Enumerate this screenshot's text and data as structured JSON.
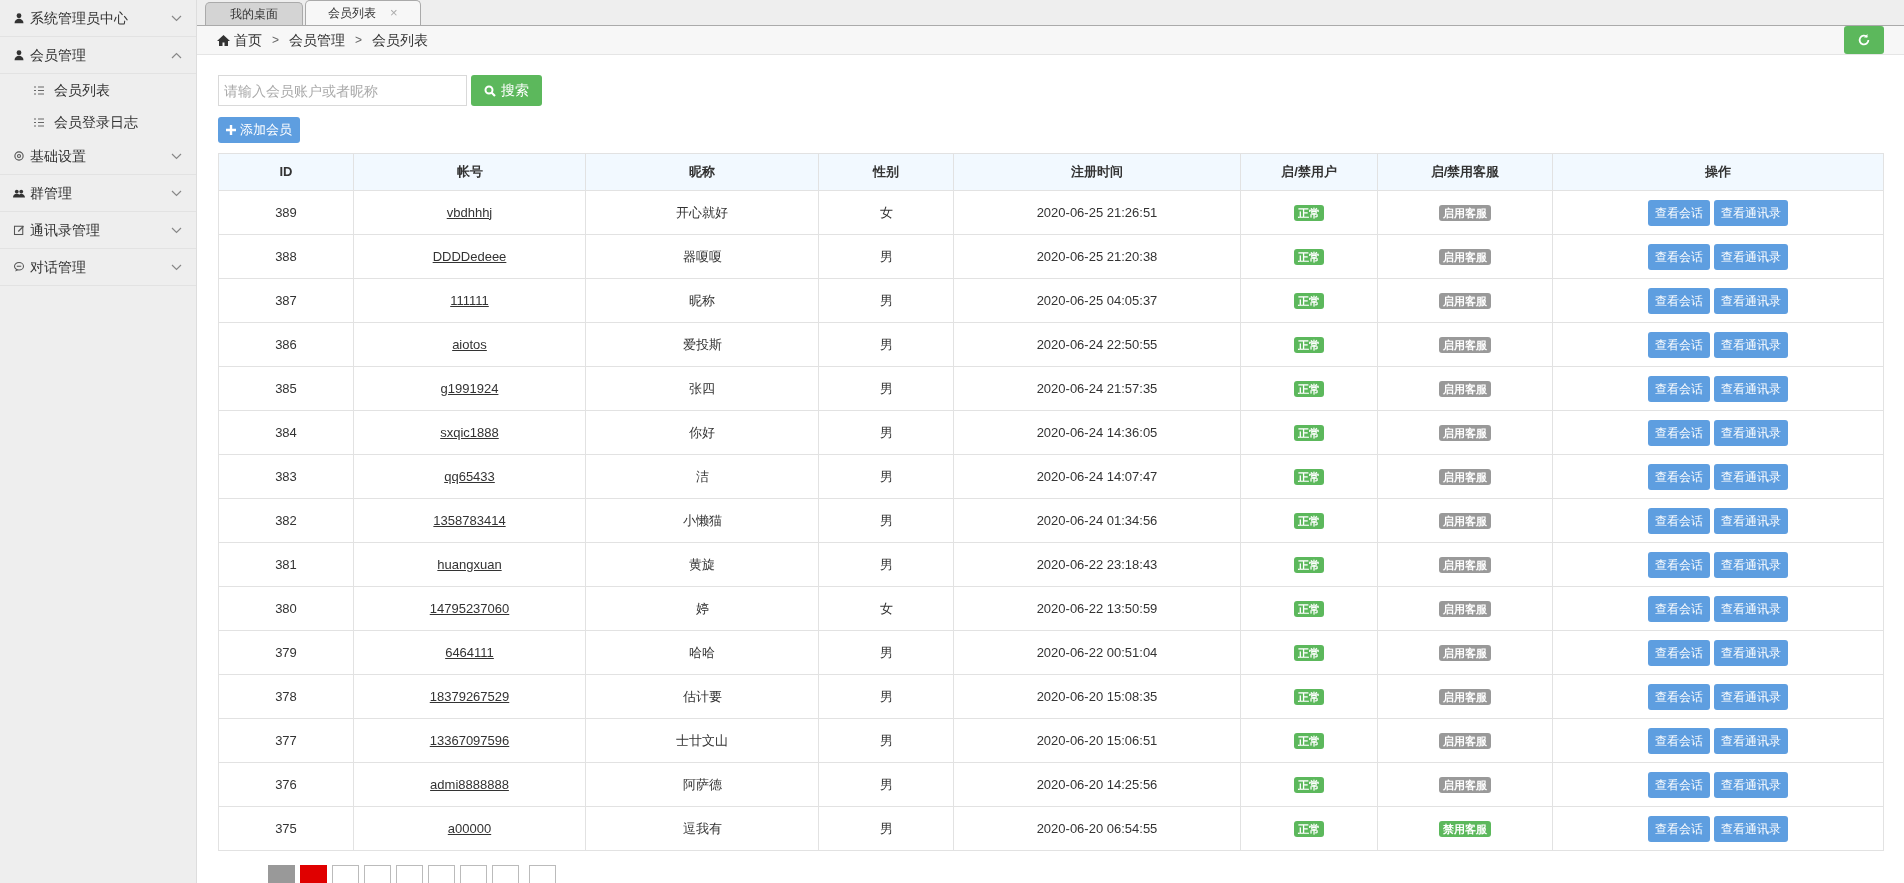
{
  "sidebar": {
    "items": [
      {
        "label": "系统管理员中心",
        "expanded": false
      },
      {
        "label": "会员管理",
        "expanded": true,
        "children": [
          {
            "label": "会员列表"
          },
          {
            "label": "会员登录日志"
          }
        ]
      },
      {
        "label": "基础设置",
        "expanded": false
      },
      {
        "label": "群管理",
        "expanded": false
      },
      {
        "label": "通讯录管理",
        "expanded": false
      },
      {
        "label": "对话管理",
        "expanded": false
      }
    ]
  },
  "tabs": [
    {
      "label": "我的桌面",
      "selected": false
    },
    {
      "label": "会员列表",
      "selected": true,
      "close": "×"
    }
  ],
  "breadcrumb": [
    "首页",
    ">",
    "会员管理",
    ">",
    "会员列表"
  ],
  "search": {
    "placeholder": "请输入会员账户或者昵称",
    "button": "搜索"
  },
  "add_button": "添加会员",
  "table": {
    "columns": [
      "ID",
      "帐号",
      "昵称",
      "性别",
      "注册时间",
      "启/禁用户",
      "启/禁用客服",
      "操作"
    ],
    "rows": [
      {
        "id": "389",
        "account": "vbdhhhj",
        "nickname": "开心就好",
        "gender": "女",
        "registered": "2020-06-25 21:26:51",
        "user_status": "正常",
        "service": "启用客服",
        "service_enabled": false,
        "actions": [
          "查看会话",
          "查看通讯录"
        ]
      },
      {
        "id": "388",
        "account": "DDDDedeee",
        "nickname": "器嗄嗄",
        "gender": "男",
        "registered": "2020-06-25 21:20:38",
        "user_status": "正常",
        "service": "启用客服",
        "service_enabled": false,
        "actions": [
          "查看会话",
          "查看通讯录"
        ]
      },
      {
        "id": "387",
        "account": "111111",
        "nickname": "昵称",
        "gender": "男",
        "registered": "2020-06-25 04:05:37",
        "user_status": "正常",
        "service": "启用客服",
        "service_enabled": false,
        "actions": [
          "查看会话",
          "查看通讯录"
        ]
      },
      {
        "id": "386",
        "account": "aiotos",
        "nickname": "爱投斯",
        "gender": "男",
        "registered": "2020-06-24 22:50:55",
        "user_status": "正常",
        "service": "启用客服",
        "service_enabled": false,
        "actions": [
          "查看会话",
          "查看通讯录"
        ]
      },
      {
        "id": "385",
        "account": "g1991924",
        "nickname": "张四",
        "gender": "男",
        "registered": "2020-06-24 21:57:35",
        "user_status": "正常",
        "service": "启用客服",
        "service_enabled": false,
        "actions": [
          "查看会话",
          "查看通讯录"
        ]
      },
      {
        "id": "384",
        "account": "sxqic1888",
        "nickname": "你好",
        "gender": "男",
        "registered": "2020-06-24 14:36:05",
        "user_status": "正常",
        "service": "启用客服",
        "service_enabled": false,
        "actions": [
          "查看会话",
          "查看通讯录"
        ]
      },
      {
        "id": "383",
        "account": "qq65433",
        "nickname": "洁",
        "gender": "男",
        "registered": "2020-06-24 14:07:47",
        "user_status": "正常",
        "service": "启用客服",
        "service_enabled": false,
        "actions": [
          "查看会话",
          "查看通讯录"
        ]
      },
      {
        "id": "382",
        "account": "1358783414",
        "nickname": "小懒猫",
        "gender": "男",
        "registered": "2020-06-24 01:34:56",
        "user_status": "正常",
        "service": "启用客服",
        "service_enabled": false,
        "actions": [
          "查看会话",
          "查看通讯录"
        ]
      },
      {
        "id": "381",
        "account": "huangxuan",
        "nickname": "黄旋",
        "gender": "男",
        "registered": "2020-06-22 23:18:43",
        "user_status": "正常",
        "service": "启用客服",
        "service_enabled": false,
        "actions": [
          "查看会话",
          "查看通讯录"
        ]
      },
      {
        "id": "380",
        "account": "14795237060",
        "nickname": "婷",
        "gender": "女",
        "registered": "2020-06-22 13:50:59",
        "user_status": "正常",
        "service": "启用客服",
        "service_enabled": false,
        "actions": [
          "查看会话",
          "查看通讯录"
        ]
      },
      {
        "id": "379",
        "account": "6464111",
        "nickname": "哈哈",
        "gender": "男",
        "registered": "2020-06-22 00:51:04",
        "user_status": "正常",
        "service": "启用客服",
        "service_enabled": false,
        "actions": [
          "查看会话",
          "查看通讯录"
        ]
      },
      {
        "id": "378",
        "account": "18379267529",
        "nickname": "估计要",
        "gender": "男",
        "registered": "2020-06-20 15:08:35",
        "user_status": "正常",
        "service": "启用客服",
        "service_enabled": false,
        "actions": [
          "查看会话",
          "查看通讯录"
        ]
      },
      {
        "id": "377",
        "account": "13367097596",
        "nickname": "士廿文山",
        "gender": "男",
        "registered": "2020-06-20 15:06:51",
        "user_status": "正常",
        "service": "启用客服",
        "service_enabled": false,
        "actions": [
          "查看会话",
          "查看通讯录"
        ]
      },
      {
        "id": "376",
        "account": "admi8888888",
        "nickname": "阿萨德",
        "gender": "男",
        "registered": "2020-06-20 14:25:56",
        "user_status": "正常",
        "service": "启用客服",
        "service_enabled": false,
        "actions": [
          "查看会话",
          "查看通讯录"
        ]
      },
      {
        "id": "375",
        "account": "a00000",
        "nickname": "逗我有",
        "gender": "男",
        "registered": "2020-06-20 06:54:55",
        "user_status": "正常",
        "service": "禁用客服",
        "service_enabled": true,
        "actions": [
          "查看会话",
          "查看通讯录"
        ]
      }
    ]
  },
  "pagination": [
    {
      "kind": "prev",
      "selected": false
    },
    {
      "kind": "page",
      "selected": true
    },
    {
      "kind": "page",
      "selected": false
    },
    {
      "kind": "page",
      "selected": false
    },
    {
      "kind": "page",
      "selected": false
    },
    {
      "kind": "page",
      "selected": false
    },
    {
      "kind": "page",
      "selected": false
    },
    {
      "kind": "page",
      "selected": false
    },
    {
      "kind": "next",
      "selected": false
    }
  ]
}
